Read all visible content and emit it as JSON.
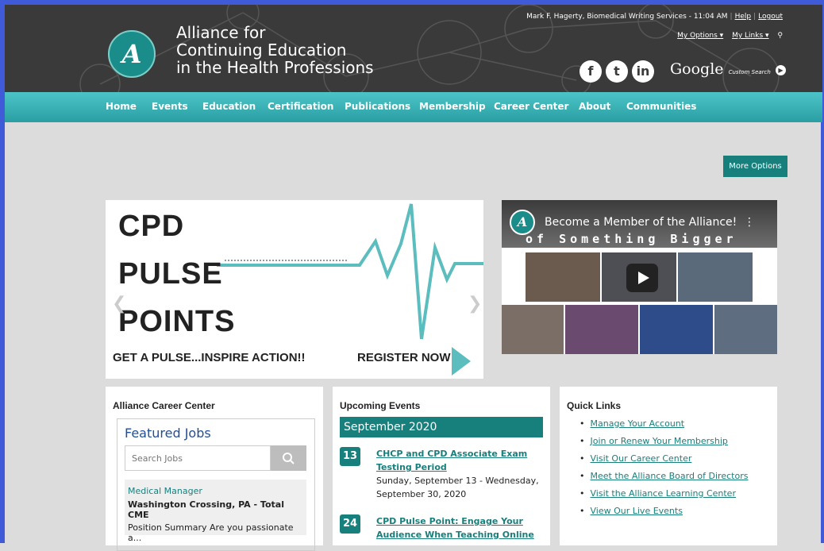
{
  "header": {
    "org_line1": "Alliance for",
    "org_line2": "Continuing Education",
    "org_line3": "in the Health Professions",
    "user_info": "Mark F. Hagerty, Biomedical Writing Services - 11:04 AM",
    "help": "Help",
    "logout": "Logout",
    "my_options": "My Options ▾",
    "my_links": "My Links ▾",
    "google": "Google",
    "custom_search": "Custom Search"
  },
  "nav": [
    "Home",
    "Events",
    "Education",
    "Certification",
    "Publications",
    "Membership",
    "Career Center",
    "About",
    "Communities"
  ],
  "more_options": "More Options",
  "banner": {
    "line1": "CPD",
    "line2": "PULSE",
    "line3": "POINTS",
    "tagline": "GET A PULSE...INSPIRE ACTION!!",
    "cta": "REGISTER NOW"
  },
  "video": {
    "title": "Become a Member of the Alliance!",
    "subtitle": "of Something Bigger"
  },
  "career": {
    "heading": "Alliance Career Center",
    "featured": "Featured Jobs",
    "search_placeholder": "Search Jobs",
    "job_title": "Medical Manager",
    "job_location": "Washington Crossing, PA - Total CME",
    "job_summary": "Position Summary Are you passionate a..."
  },
  "events": {
    "heading": "Upcoming Events",
    "month": "September 2020",
    "items": [
      {
        "day": "13",
        "title": "CHCP and CPD Associate Exam Testing Period",
        "when": "Sunday, September 13 - Wednesday, September 30, 2020"
      },
      {
        "day": "24",
        "title": "CPD Pulse Point: Engage Your Audience When Teaching Online",
        "when": ""
      }
    ]
  },
  "quick_links": {
    "heading": "Quick Links",
    "items": [
      "Manage Your Account",
      "Join or Renew Your Membership",
      "Visit Our Career Center",
      "Meet the Alliance Board of Directors",
      "Visit the Alliance Learning Center",
      "View Our Live Events"
    ]
  }
}
